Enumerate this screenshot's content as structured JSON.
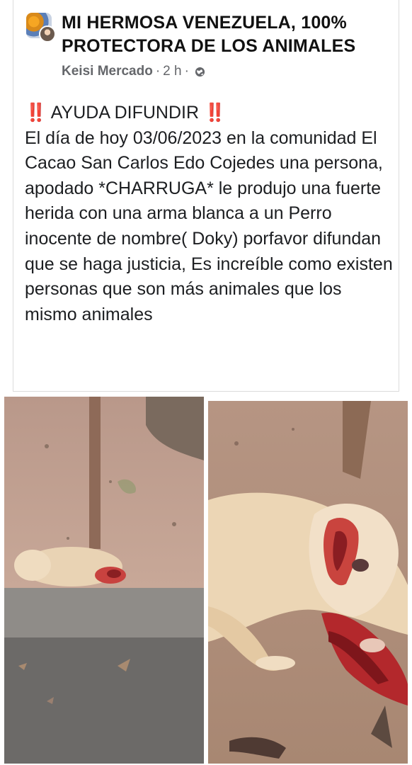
{
  "post": {
    "group_name": "MI HERMOSA VENEZUELA, 100% PROTECTORA DE LOS ANIMALES",
    "author": "Keisi Mercado",
    "separator": "·",
    "time": "2 h",
    "privacy_icon": "globe-icon",
    "text": {
      "heading": "AYUDA DIFUNDIR",
      "heading_emoji": "‼️",
      "body": "El día de hoy 03/06/2023 en la comunidad El Cacao San Carlos Edo Cojedes una persona, apodado *CHARRUGA*  le produjo una fuerte herida con una arma blanca a un Perro inocente de nombre( Doky) porfavor difundan que se haga justicia, Es increíble como existen personas que son más animales que los mismo animales"
    }
  },
  "photos": [
    {
      "name": "photo-injured-dog-on-curb"
    },
    {
      "name": "photo-injured-dog-closeup"
    }
  ],
  "colors": {
    "emoji_red": "#e0245e",
    "meta_gray": "#65676b",
    "text": "#1c1e21"
  }
}
